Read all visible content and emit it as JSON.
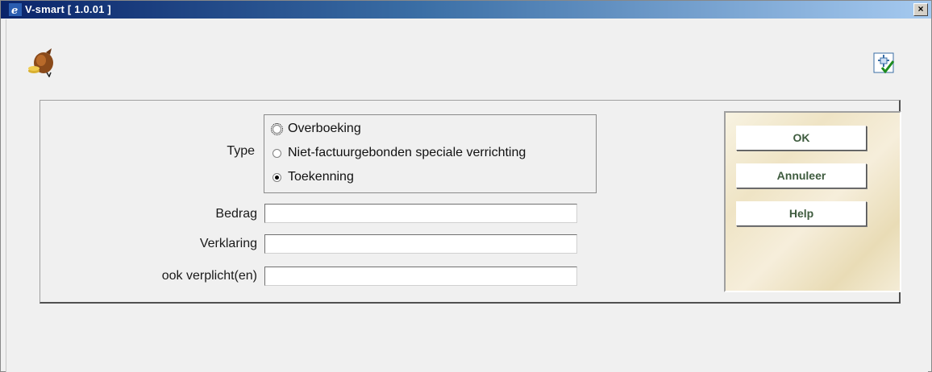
{
  "window": {
    "title": "V-smart [ 1.0.01 ]",
    "close_label": "×"
  },
  "form": {
    "type_label": "Type",
    "type_options": [
      {
        "label": "Overboeking",
        "checked": false
      },
      {
        "label": "Niet-factuurgebonden speciale verrichting",
        "checked": false
      },
      {
        "label": "Toekenning",
        "checked": true
      }
    ],
    "fields": [
      {
        "label": "Bedrag",
        "value": ""
      },
      {
        "label": "Verklaring",
        "value": ""
      },
      {
        "label": "ook verplicht(en)",
        "value": ""
      }
    ]
  },
  "buttons": {
    "ok": "OK",
    "cancel": "Annuleer",
    "help": "Help"
  },
  "icons": {
    "app": "money-bag-icon",
    "options": "options-checklist-icon",
    "window": "ie-icon"
  },
  "colors": {
    "titlebar_start": "#0a246a",
    "titlebar_end": "#a6caf0",
    "button_text": "#3e5b3e"
  }
}
